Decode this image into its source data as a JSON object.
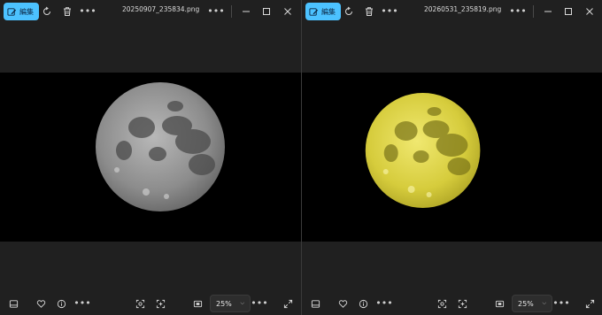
{
  "windows": [
    {
      "filename": "20250907_235834.png",
      "edit_label": "編集",
      "moon_color": "#9a9a9a",
      "zoom": "25%"
    },
    {
      "filename": "20260531_235819.png",
      "edit_label": "編集",
      "moon_color": "#e0d64a",
      "zoom": "25%"
    }
  ],
  "colors": {
    "accent": "#4cc2ff",
    "background": "#202020",
    "image_background": "#000000"
  },
  "icons": [
    "edit-icon",
    "rotate-icon",
    "delete-icon",
    "more-icon",
    "minimize-icon",
    "maximize-icon",
    "close-icon",
    "filmstrip-icon",
    "favorite-icon",
    "info-icon",
    "visual-search-icon",
    "crop-icon",
    "fit-icon",
    "chevron-down-icon",
    "fullscreen-icon"
  ]
}
